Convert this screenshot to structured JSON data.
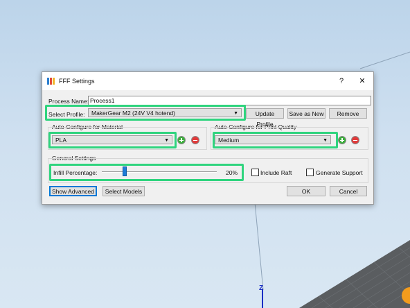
{
  "dialog": {
    "title": "FFF Settings",
    "help_glyph": "?",
    "close_glyph": "✕",
    "process_name_label": "Process Name:",
    "process_name_value": "Process1",
    "select_profile_label": "Select Profile:",
    "select_profile_value": "MakerGear M2 (24V V4 hotend)",
    "update_profile_label": "Update Profile",
    "save_as_new_label": "Save as New",
    "remove_label": "Remove",
    "material_group_label": "Auto-Configure for Material",
    "material_value": "PLA",
    "quality_group_label": "Auto-Configure for Print Quality",
    "quality_value": "Medium",
    "general_group_label": "General Settings",
    "infill_label": "Infill Percentage:",
    "infill_value_text": "20%",
    "infill_fraction": 0.2,
    "include_raft_label": "Include Raft",
    "generate_support_label": "Generate Support",
    "show_advanced_label": "Show Advanced",
    "select_models_label": "Select Models",
    "ok_label": "OK",
    "cancel_label": "Cancel"
  },
  "viewport": {
    "axis_label": "Z"
  },
  "colors": {
    "highlight": "#2fd47e",
    "slider": "#1e7bd7",
    "add": "#3bb03b",
    "remove": "#e23b3b"
  }
}
